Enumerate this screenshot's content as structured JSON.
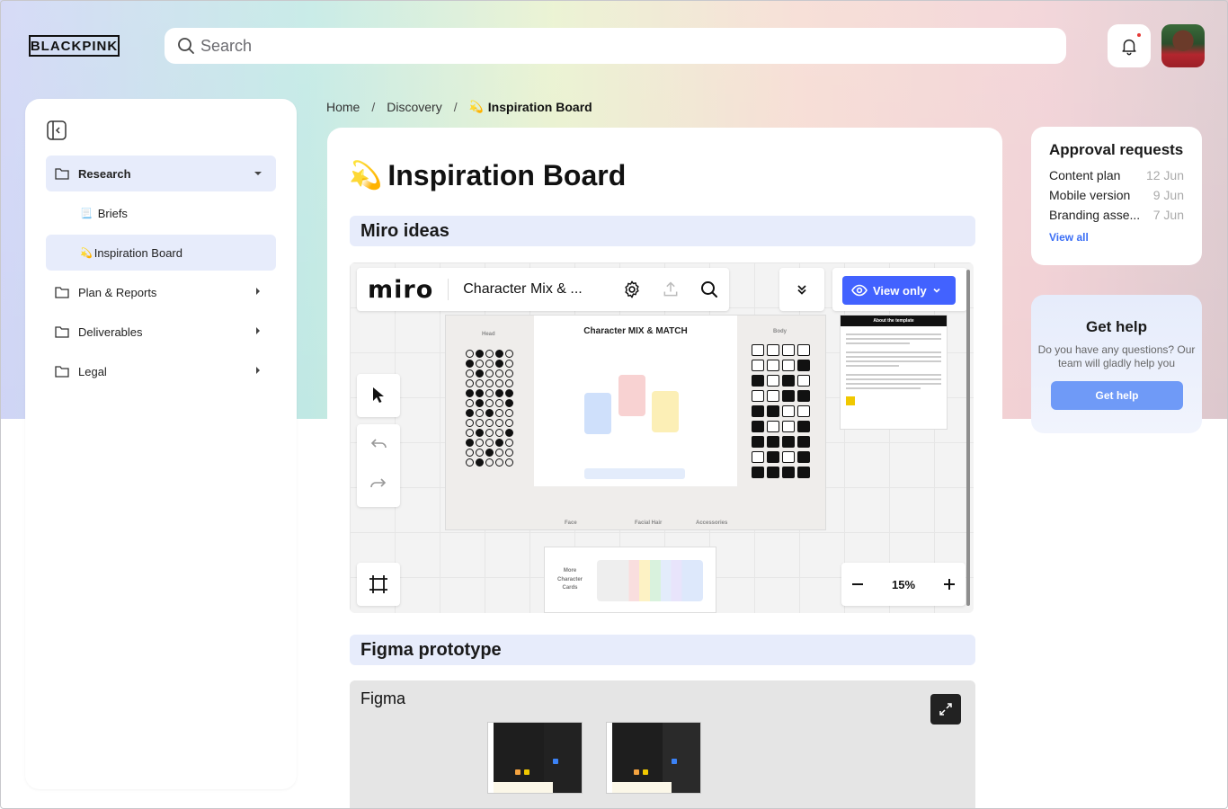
{
  "brand": {
    "logo_text": "BLACKPINK"
  },
  "search": {
    "placeholder": "Search"
  },
  "sidebar": {
    "items": [
      {
        "label": "Research",
        "expanded": true,
        "active": true
      },
      {
        "label": "Briefs",
        "icon": "📃"
      },
      {
        "label": "Inspiration Board",
        "icon": "💫",
        "active": true
      },
      {
        "label": "Plan & Reports"
      },
      {
        "label": "Deliverables"
      },
      {
        "label": "Legal"
      }
    ]
  },
  "breadcrumb": {
    "home": "Home",
    "discovery": "Discovery",
    "current_icon": "💫",
    "current": "Inspiration Board"
  },
  "main": {
    "title_icon": "💫",
    "title": "Inspiration Board",
    "miro_section": "Miro ideas",
    "figma_section": "Figma prototype"
  },
  "miro": {
    "logo": "miro",
    "board_name": "Character Mix & ...",
    "view_only": "View only",
    "zoom": "15%",
    "board_title": "Character MIX & MATCH",
    "head_label": "Head",
    "body_label": "Body",
    "face_label": "Face",
    "facial_hair_label": "Facial Hair",
    "accessories_label": "Accessories",
    "about_title": "About the template",
    "more_cards": "More Character Cards"
  },
  "figma": {
    "label": "Figma"
  },
  "approvals": {
    "title": "Approval requests",
    "items": [
      {
        "name": "Content plan",
        "date": "12 Jun"
      },
      {
        "name": "Mobile version",
        "date": "9 Jun"
      },
      {
        "name": "Branding asse...",
        "date": "7 Jun"
      }
    ],
    "view_all": "View all"
  },
  "help": {
    "title": "Get help",
    "text": "Do you have any questions? Our team will gladly help you",
    "button": "Get help"
  },
  "colors": {
    "accent": "#4262ff",
    "active_bg": "#e7ecfb",
    "link": "#3b6ef5",
    "help_button": "#6f9af7"
  }
}
